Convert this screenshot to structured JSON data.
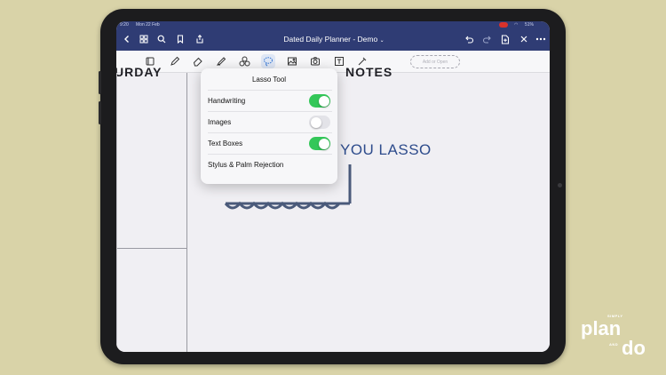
{
  "status_bar": {
    "time": "9:20",
    "date": "Mon 22 Feb",
    "battery": "51%"
  },
  "nav": {
    "title": "Dated Daily Planner - Demo",
    "title_chevron": "chevron-down-icon"
  },
  "toolbar": {
    "add_placeholder": "Add or Open"
  },
  "page": {
    "left_heading": "URDAY",
    "right_heading": "NOTES",
    "handwriting_text": "YOU LASSO"
  },
  "popover": {
    "title": "Lasso Tool",
    "items": [
      {
        "label": "Handwriting",
        "state": "on"
      },
      {
        "label": "Images",
        "state": "off"
      },
      {
        "label": "Text Boxes",
        "state": "on"
      },
      {
        "label": "Stylus & Palm Rejection"
      }
    ]
  },
  "brand": {
    "top": "SIMPLY",
    "main1": "plan",
    "and": "AND",
    "main2": "do"
  },
  "colors": {
    "nav": "#2f3c74",
    "accent_toggle": "#34c759",
    "ink": "#2e4c8c",
    "background": "#d9d3a8"
  }
}
